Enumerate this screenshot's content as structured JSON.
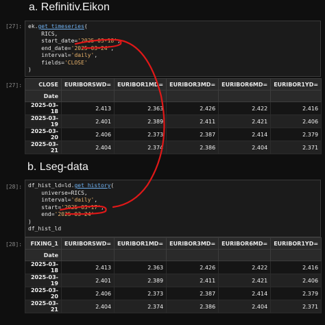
{
  "sections": {
    "a_title": "a. Refinitiv.Eikon",
    "b_title": "b. Lseg-data"
  },
  "cell1": {
    "prompt": "[27]:",
    "lines": {
      "l1_pre": "ek.",
      "l1_fn": "get_timeseries",
      "l1_post": "(",
      "l2": "    RICS,",
      "l3_pre": "    start_date=",
      "l3_str": "'2025-03-18'",
      "l3_post": ",",
      "l4_pre": "    end_date=",
      "l4_str": "'2025-03-24'",
      "l4_post": ",",
      "l5_pre": "    interval=",
      "l5_str": "'daily'",
      "l5_post": ",",
      "l6_pre": "    fields=",
      "l6_str": "'CLOSE'",
      "l7": ")"
    }
  },
  "out1": {
    "prompt": "[27]:",
    "corner": "CLOSE",
    "index_name": "Date",
    "columns": [
      "EURIBORSWD=",
      "EURIBOR1MD=",
      "EURIBOR3MD=",
      "EURIBOR6MD=",
      "EURIBOR1YD="
    ],
    "rows": [
      [
        "2025-03-18",
        "2.413",
        "2.363",
        "2.426",
        "2.422",
        "2.416"
      ],
      [
        "2025-03-19",
        "2.401",
        "2.389",
        "2.411",
        "2.421",
        "2.406"
      ],
      [
        "2025-03-20",
        "2.406",
        "2.373",
        "2.387",
        "2.414",
        "2.379"
      ],
      [
        "2025-03-21",
        "2.404",
        "2.374",
        "2.386",
        "2.404",
        "2.371"
      ]
    ]
  },
  "cell2": {
    "prompt": "[28]:",
    "lines": {
      "l1_pre": "df_hist_ld=ld.",
      "l1_fn": "get_history",
      "l1_post": "(",
      "l2": "    universe=RICS,",
      "l3_pre": "    interval=",
      "l3_str": "'daily'",
      "l3_post": ",",
      "l4_pre": "    start=",
      "l4_str": "'2025-03-17'",
      "l4_post": ",",
      "l5_pre": "    end=",
      "l5_str": "'2025-03-24'",
      "l6": ")",
      "l7": "df_hist_ld"
    }
  },
  "out2": {
    "prompt": "[28]:",
    "corner": "FIXING_1",
    "index_name": "Date",
    "columns": [
      "EURIBORSWD=",
      "EURIBOR1MD=",
      "EURIBOR3MD=",
      "EURIBOR6MD=",
      "EURIBOR1YD="
    ],
    "rows": [
      [
        "2025-03-18",
        "2.413",
        "2.363",
        "2.426",
        "2.422",
        "2.416"
      ],
      [
        "2025-03-19",
        "2.401",
        "2.389",
        "2.411",
        "2.421",
        "2.406"
      ],
      [
        "2025-03-20",
        "2.406",
        "2.373",
        "2.387",
        "2.414",
        "2.379"
      ],
      [
        "2025-03-21",
        "2.404",
        "2.374",
        "2.386",
        "2.404",
        "2.371"
      ]
    ]
  },
  "colors": {
    "annotation": "#e01818",
    "string": "#e8b26a",
    "function": "#6fb1f1"
  }
}
